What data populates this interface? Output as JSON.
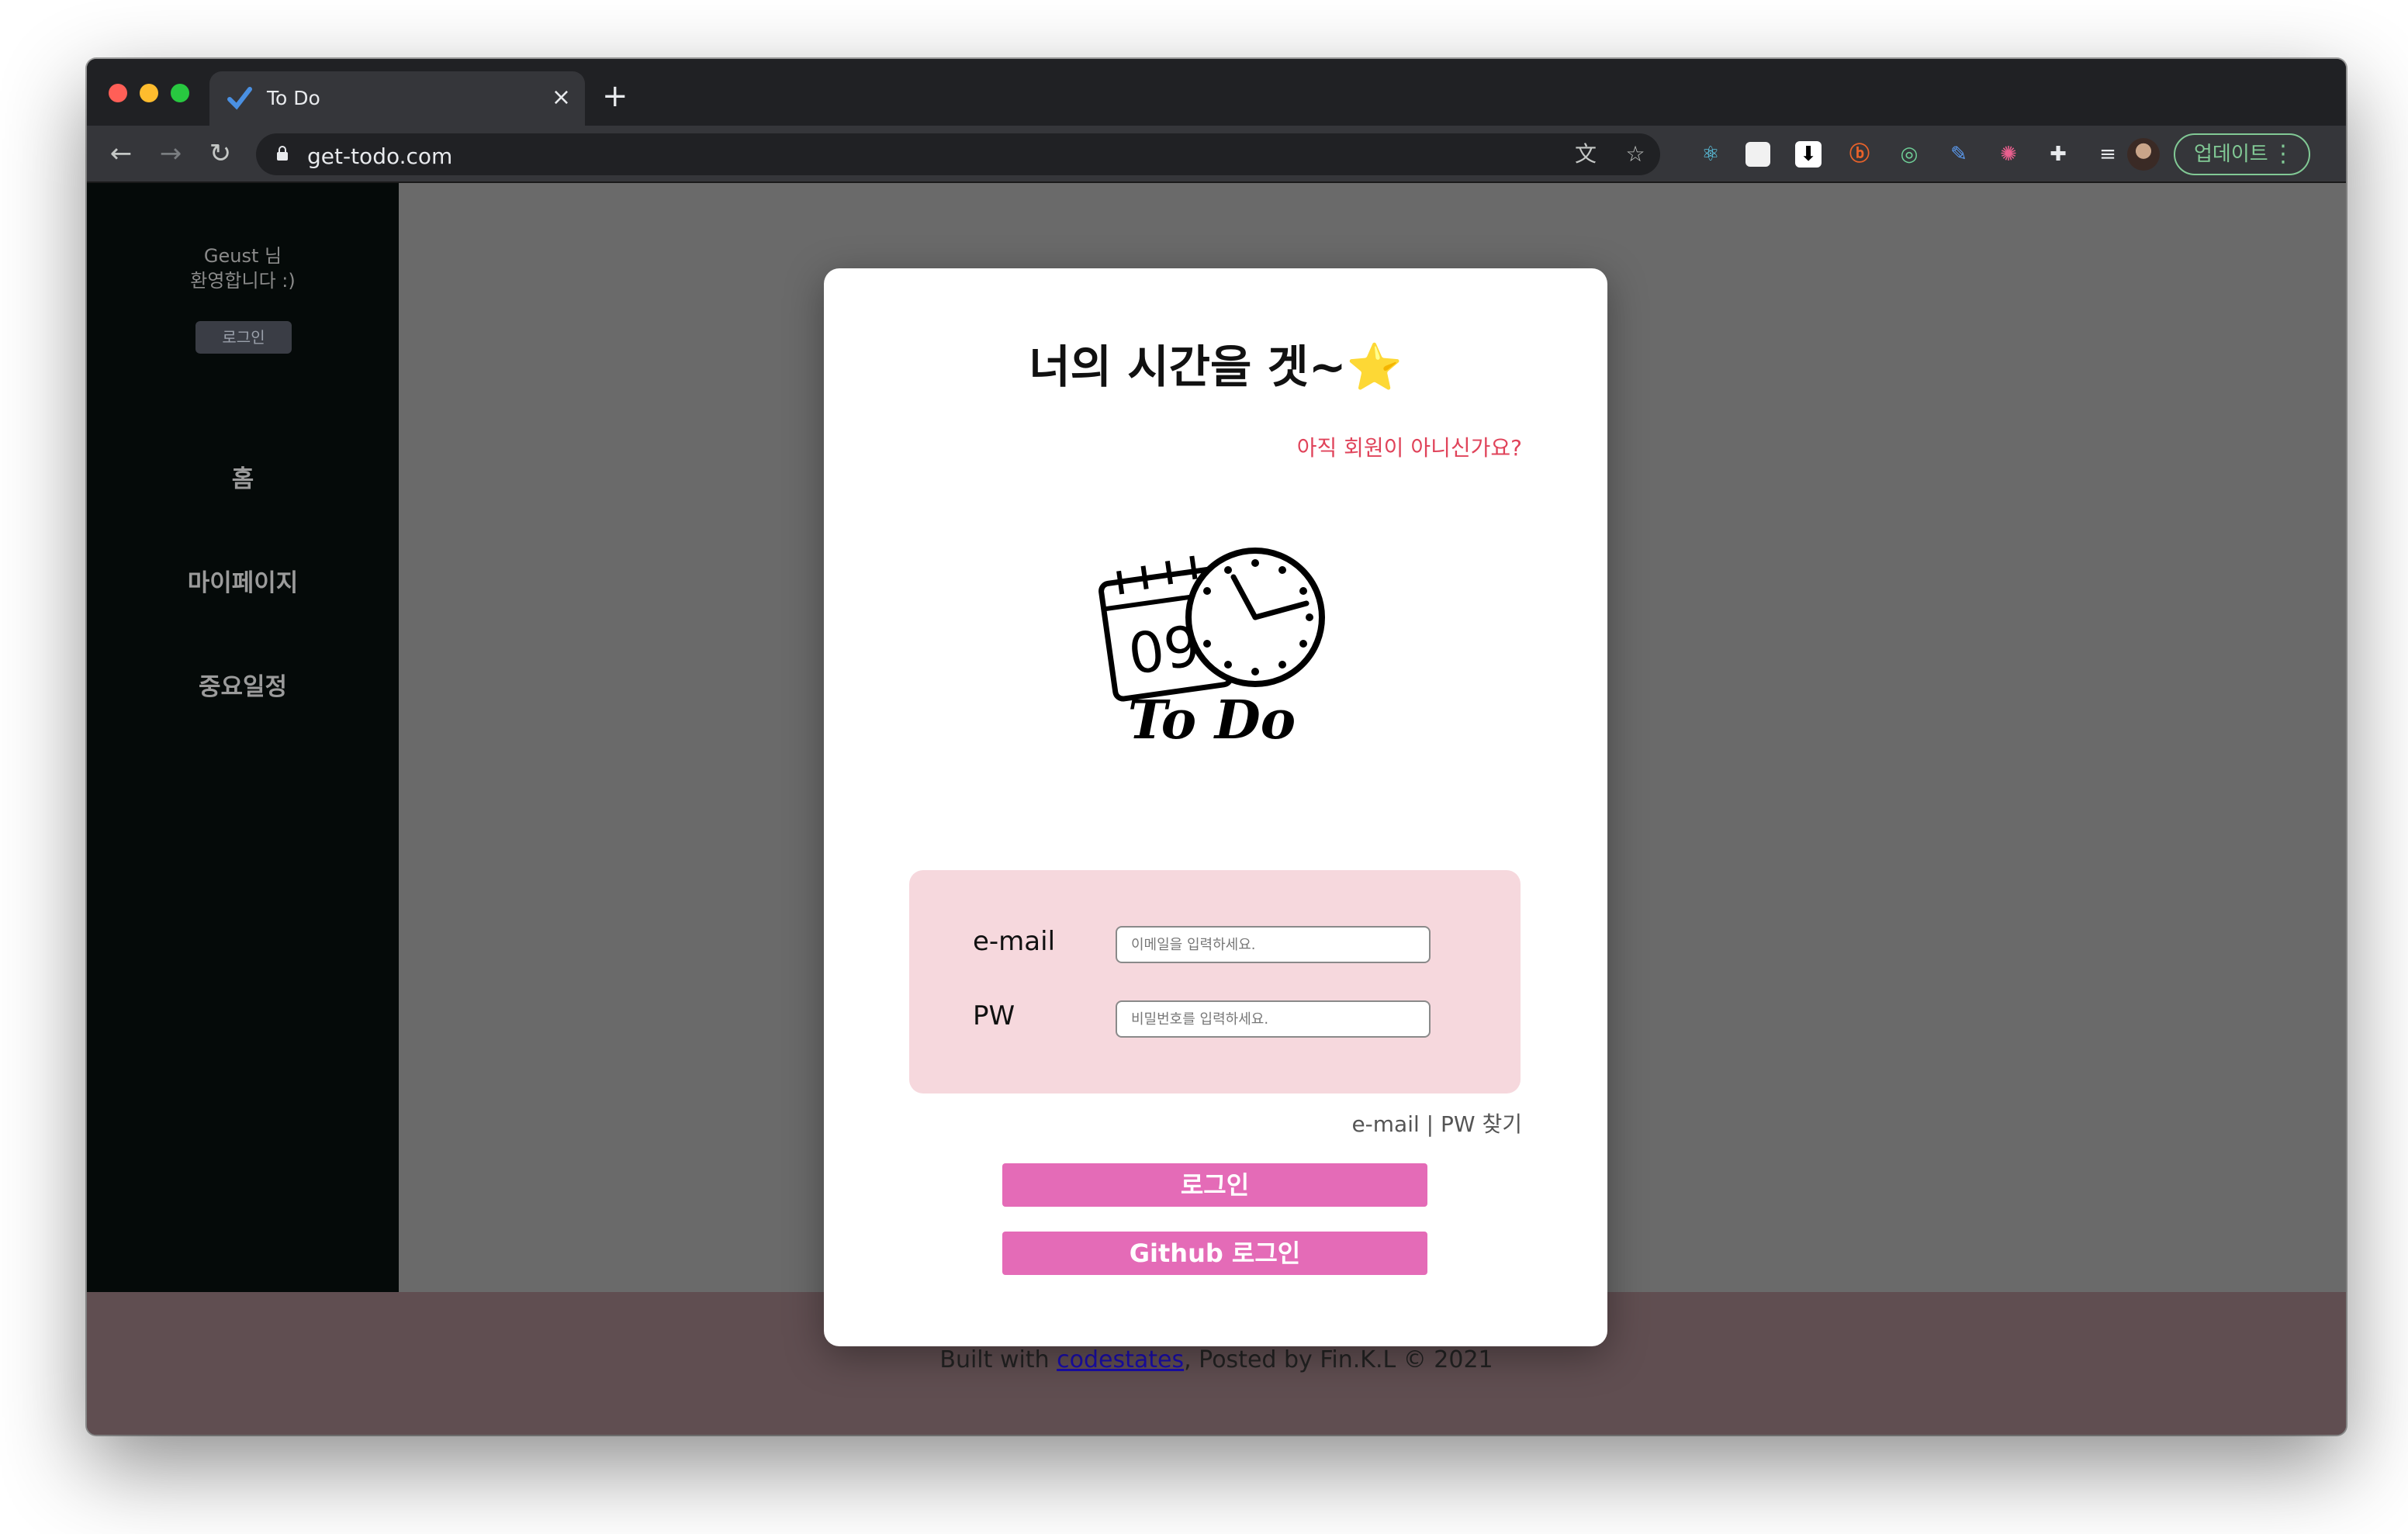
{
  "browser": {
    "tab_title": "To Do",
    "tab_close": "×",
    "new_tab": "+",
    "url": "get-todo.com",
    "update_label": "업데이트",
    "extensions": [
      "react-icon",
      "white-square-icon",
      "download-icon",
      "b-icon",
      "target-icon",
      "edit-icon",
      "color-wheel-icon",
      "puzzle-icon",
      "playlist-icon"
    ]
  },
  "sidebar": {
    "greeting_line1": "Geust 님",
    "greeting_line2": "환영합니다 :)",
    "login_label": "로그인",
    "nav": [
      {
        "label": "홈"
      },
      {
        "label": "마이페이지"
      },
      {
        "label": "중요일정"
      }
    ]
  },
  "modal": {
    "title": "너의 시간을 겟~⭐",
    "signup_link": "아직 회원이 아니신가요?",
    "logo_text": "To Do",
    "logo_day": "09",
    "email_label": "e-mail",
    "email_placeholder": "이메일을 입력하세요.",
    "pw_label": "PW",
    "pw_placeholder": "비밀번호를 입력하세요.",
    "find_link": "e-mail | PW 찾기",
    "login_button": "로그인",
    "github_button": "Github 로그인"
  },
  "footer": {
    "prefix": "Built with ",
    "link": "codestates",
    "suffix": ", Posted by Fin.K.L © 2021"
  },
  "colors": {
    "accent_pink": "#e46bb7",
    "form_bg": "#f6d8dd",
    "signup_red": "#e0435a",
    "sidebar_bg": "#050a09",
    "footer_bg": "#604e51"
  }
}
